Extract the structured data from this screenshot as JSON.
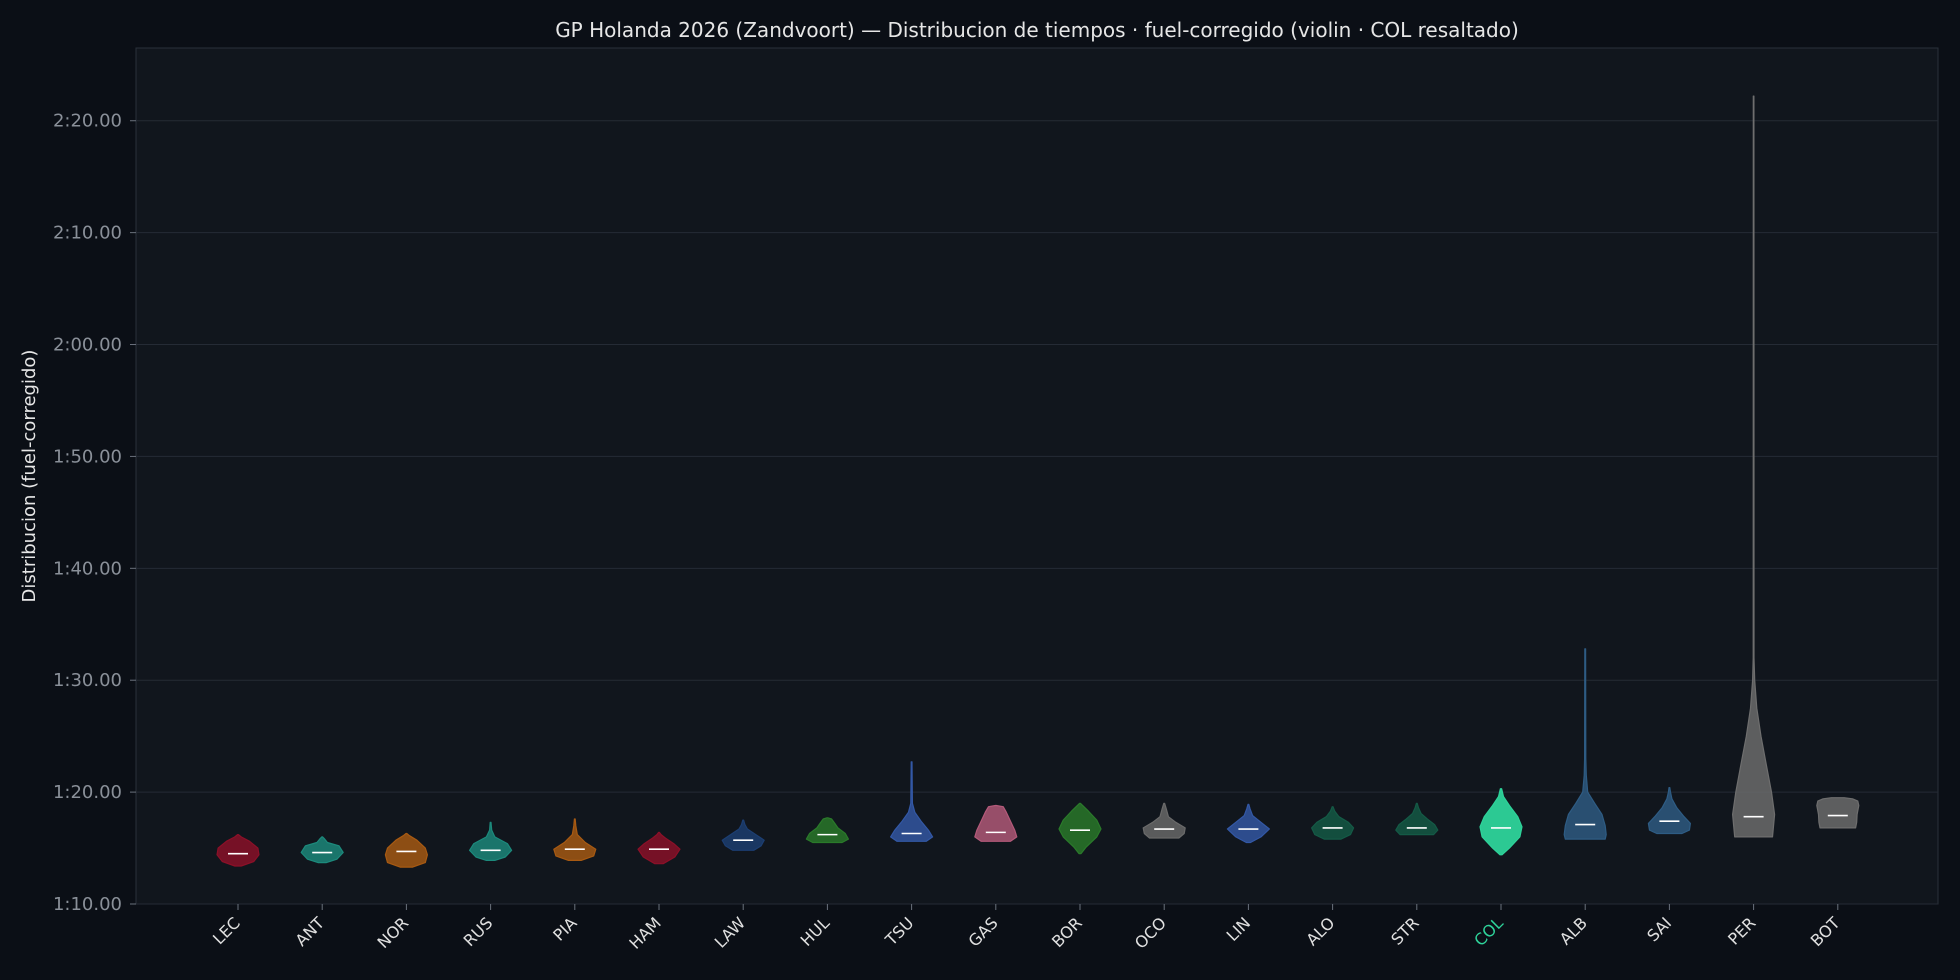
{
  "chart_data": {
    "type": "violin",
    "title": "GP Holanda 2026 (Zandvoort) — Distribucion de tiempos · fuel-corregido (violin · COL resaltado)",
    "xlabel": "",
    "ylabel": "Distribucion (fuel-corregido)",
    "ylim_seconds": [
      70,
      146.5
    ],
    "y_ticks": [
      {
        "value": 70,
        "label": "1:10.00"
      },
      {
        "value": 80,
        "label": "1:20.00"
      },
      {
        "value": 90,
        "label": "1:30.00"
      },
      {
        "value": 100,
        "label": "1:40.00"
      },
      {
        "value": 110,
        "label": "1:50.00"
      },
      {
        "value": 120,
        "label": "2:00.00"
      },
      {
        "value": 130,
        "label": "2:10.00"
      },
      {
        "value": 140,
        "label": "2:20.00"
      }
    ],
    "grid": "horizontal",
    "highlight": "COL",
    "highlight_color": "#2ed39a",
    "drivers": [
      {
        "code": "LEC",
        "color": "#8c1028",
        "median": 74.5,
        "profile": [
          [
            73.4,
            0.15
          ],
          [
            73.8,
            0.75
          ],
          [
            74.4,
            1.0
          ],
          [
            75.0,
            0.95
          ],
          [
            75.6,
            0.55
          ],
          [
            76.0,
            0.15
          ],
          [
            76.2,
            0.02
          ]
        ]
      },
      {
        "code": "ANT",
        "color": "#1c8a7c",
        "median": 74.6,
        "profile": [
          [
            73.7,
            0.2
          ],
          [
            74.0,
            0.7
          ],
          [
            74.6,
            1.0
          ],
          [
            75.2,
            0.8
          ],
          [
            75.5,
            0.25
          ],
          [
            75.8,
            0.12
          ],
          [
            76.0,
            0.02
          ]
        ]
      },
      {
        "code": "NOR",
        "color": "#a85a12",
        "median": 74.7,
        "profile": [
          [
            73.3,
            0.3
          ],
          [
            73.7,
            0.9
          ],
          [
            74.4,
            1.0
          ],
          [
            75.0,
            0.9
          ],
          [
            75.7,
            0.5
          ],
          [
            76.1,
            0.15
          ],
          [
            76.3,
            0.02
          ]
        ]
      },
      {
        "code": "RUS",
        "color": "#1c8a7c",
        "median": 74.8,
        "profile": [
          [
            73.9,
            0.2
          ],
          [
            74.2,
            0.7
          ],
          [
            74.8,
            1.0
          ],
          [
            75.4,
            0.8
          ],
          [
            76.0,
            0.2
          ],
          [
            76.6,
            0.05
          ],
          [
            77.3,
            0.02
          ]
        ]
      },
      {
        "code": "PIA",
        "color": "#a85a12",
        "median": 74.9,
        "profile": [
          [
            73.9,
            0.3
          ],
          [
            74.3,
            0.9
          ],
          [
            74.9,
            1.0
          ],
          [
            75.5,
            0.5
          ],
          [
            76.2,
            0.12
          ],
          [
            77.0,
            0.05
          ],
          [
            77.6,
            0.02
          ]
        ]
      },
      {
        "code": "HAM",
        "color": "#8c1028",
        "median": 74.9,
        "profile": [
          [
            73.6,
            0.2
          ],
          [
            74.2,
            0.75
          ],
          [
            74.9,
            1.0
          ],
          [
            75.4,
            0.7
          ],
          [
            75.9,
            0.3
          ],
          [
            76.2,
            0.1
          ],
          [
            76.4,
            0.02
          ]
        ]
      },
      {
        "code": "LAW",
        "color": "#1c3e72",
        "median": 75.7,
        "profile": [
          [
            74.8,
            0.5
          ],
          [
            75.2,
            0.85
          ],
          [
            75.7,
            1.0
          ],
          [
            76.2,
            0.6
          ],
          [
            76.7,
            0.2
          ],
          [
            77.1,
            0.08
          ],
          [
            77.5,
            0.02
          ]
        ]
      },
      {
        "code": "HUL",
        "color": "#2a7a2a",
        "median": 76.2,
        "profile": [
          [
            75.5,
            0.7
          ],
          [
            75.8,
            1.0
          ],
          [
            76.3,
            0.85
          ],
          [
            76.8,
            0.5
          ],
          [
            77.2,
            0.35
          ],
          [
            77.6,
            0.2
          ],
          [
            77.7,
            0.02
          ]
        ]
      },
      {
        "code": "TSU",
        "color": "#3358a6",
        "median": 76.3,
        "profile": [
          [
            75.6,
            0.7
          ],
          [
            76.0,
            1.0
          ],
          [
            76.6,
            0.8
          ],
          [
            77.4,
            0.45
          ],
          [
            78.2,
            0.15
          ],
          [
            79.0,
            0.04
          ],
          [
            82.7,
            0.02
          ]
        ]
      },
      {
        "code": "GAS",
        "color": "#b45a7a",
        "median": 76.4,
        "profile": [
          [
            75.6,
            0.7
          ],
          [
            76.0,
            1.0
          ],
          [
            76.6,
            0.9
          ],
          [
            77.4,
            0.7
          ],
          [
            78.2,
            0.5
          ],
          [
            78.7,
            0.35
          ],
          [
            78.8,
            0.02
          ]
        ]
      },
      {
        "code": "BOR",
        "color": "#2a7a2a",
        "median": 76.6,
        "profile": [
          [
            74.5,
            0.05
          ],
          [
            75.1,
            0.3
          ],
          [
            76.0,
            0.8
          ],
          [
            76.7,
            1.0
          ],
          [
            77.5,
            0.8
          ],
          [
            78.3,
            0.4
          ],
          [
            79.0,
            0.02
          ]
        ]
      },
      {
        "code": "OCO",
        "color": "#6a6a6a",
        "median": 76.7,
        "profile": [
          [
            75.9,
            0.7
          ],
          [
            76.3,
            0.95
          ],
          [
            76.8,
            1.0
          ],
          [
            77.3,
            0.55
          ],
          [
            77.8,
            0.2
          ],
          [
            78.5,
            0.1
          ],
          [
            79.0,
            0.02
          ]
        ]
      },
      {
        "code": "LIN",
        "color": "#3358a6",
        "median": 76.7,
        "profile": [
          [
            75.5,
            0.1
          ],
          [
            76.0,
            0.6
          ],
          [
            76.7,
            1.0
          ],
          [
            77.3,
            0.6
          ],
          [
            77.9,
            0.2
          ],
          [
            78.5,
            0.08
          ],
          [
            78.9,
            0.02
          ]
        ]
      },
      {
        "code": "ALO",
        "color": "#145a46",
        "median": 76.8,
        "profile": [
          [
            75.8,
            0.4
          ],
          [
            76.2,
            0.85
          ],
          [
            76.8,
            1.0
          ],
          [
            77.3,
            0.75
          ],
          [
            77.8,
            0.3
          ],
          [
            78.3,
            0.1
          ],
          [
            78.7,
            0.02
          ]
        ]
      },
      {
        "code": "STR",
        "color": "#145a46",
        "median": 76.8,
        "profile": [
          [
            76.2,
            0.8
          ],
          [
            76.6,
            1.0
          ],
          [
            77.1,
            0.85
          ],
          [
            77.6,
            0.5
          ],
          [
            78.1,
            0.2
          ],
          [
            78.6,
            0.08
          ],
          [
            79.0,
            0.02
          ]
        ]
      },
      {
        "code": "COL",
        "color": "#2ed39a",
        "median": 76.8,
        "profile": [
          [
            74.4,
            0.05
          ],
          [
            75.0,
            0.4
          ],
          [
            76.0,
            0.9
          ],
          [
            76.9,
            1.0
          ],
          [
            77.8,
            0.8
          ],
          [
            78.8,
            0.4
          ],
          [
            79.6,
            0.12
          ],
          [
            80.3,
            0.03
          ]
        ]
      },
      {
        "code": "ALB",
        "color": "#2e5c84",
        "median": 77.1,
        "profile": [
          [
            75.8,
            0.95
          ],
          [
            76.2,
            1.0
          ],
          [
            77.0,
            0.95
          ],
          [
            78.0,
            0.8
          ],
          [
            79.0,
            0.45
          ],
          [
            80.0,
            0.12
          ],
          [
            81.5,
            0.05
          ],
          [
            83.0,
            0.03
          ],
          [
            92.8,
            0.02
          ]
        ]
      },
      {
        "code": "SAI",
        "color": "#2e5c84",
        "median": 77.4,
        "profile": [
          [
            76.3,
            0.6
          ],
          [
            76.6,
            0.95
          ],
          [
            77.2,
            1.0
          ],
          [
            77.8,
            0.7
          ],
          [
            78.6,
            0.35
          ],
          [
            79.4,
            0.12
          ],
          [
            80.0,
            0.05
          ],
          [
            80.4,
            0.02
          ]
        ]
      },
      {
        "code": "PER",
        "color": "#6e6e6e",
        "median": 77.8,
        "profile": [
          [
            76.0,
            0.9
          ],
          [
            78.0,
            1.0
          ],
          [
            80.0,
            0.85
          ],
          [
            82.5,
            0.6
          ],
          [
            85.0,
            0.35
          ],
          [
            87.5,
            0.15
          ],
          [
            90.0,
            0.05
          ],
          [
            92.0,
            0.02
          ],
          [
            142.2,
            0.012
          ]
        ]
      },
      {
        "code": "BOT",
        "color": "#6e6e6e",
        "median": 77.9,
        "profile": [
          [
            76.8,
            0.85
          ],
          [
            77.3,
            0.9
          ],
          [
            78.0,
            0.92
          ],
          [
            78.8,
            1.0
          ],
          [
            79.2,
            0.95
          ],
          [
            79.4,
            0.7
          ],
          [
            79.5,
            0.3
          ]
        ]
      }
    ]
  }
}
